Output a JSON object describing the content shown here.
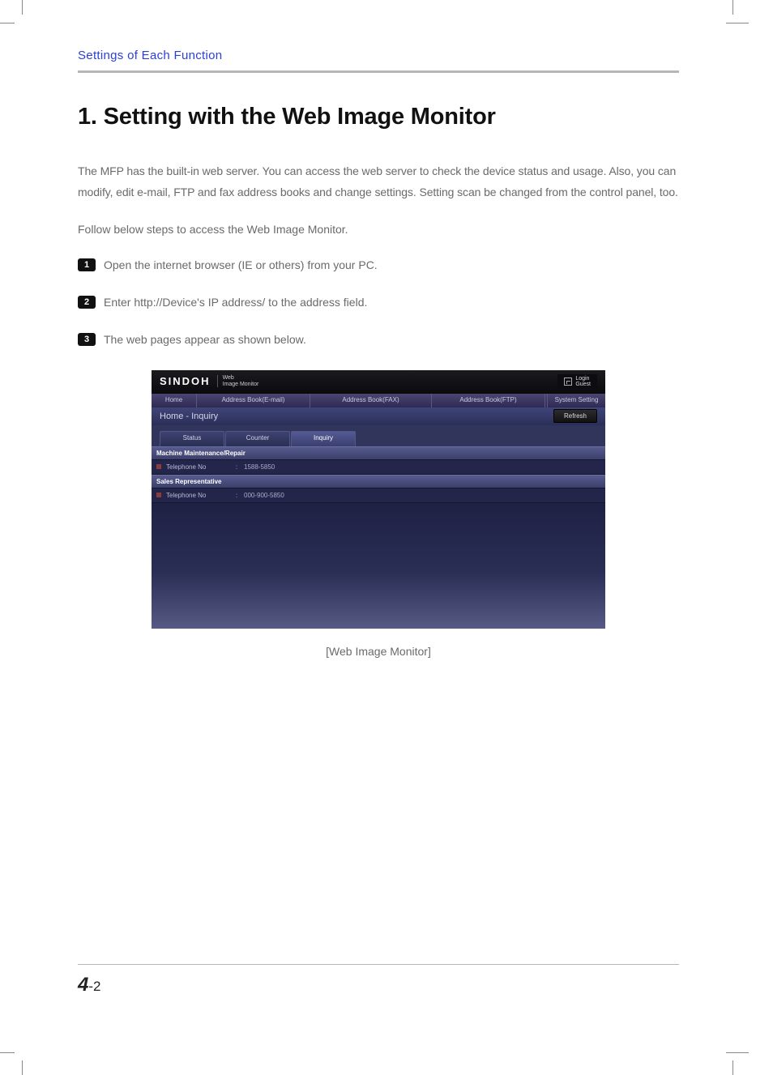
{
  "section_title": "Settings of Each Function",
  "heading": "1. Setting with the Web Image Monitor",
  "para1": "The MFP has the built-in web server. You can access the web server to check the device status and usage. Also, you can modify, edit e-mail, FTP and fax address books and change settings. Setting scan be changed from the control panel, too.",
  "para2": "Follow below steps to access the Web Image Monitor.",
  "steps": {
    "s1": "Open the internet browser (IE or others) from your PC.",
    "s2": "Enter http://Device's IP address/ to the address field.",
    "s3": "The web pages appear as shown below."
  },
  "figure": {
    "logo": "SINDOH",
    "sub1": "Web",
    "sub2": "Image Monitor",
    "login_line1": "Login",
    "login_line2": "Guest",
    "nav": {
      "home": "Home",
      "email": "Address Book(E-mail)",
      "fax": "Address Book(FAX)",
      "ftp": "Address Book(FTP)",
      "sys": "System Setting"
    },
    "breadcrumb": "Home - Inquiry",
    "refresh": "Refresh",
    "tabs": {
      "status": "Status",
      "counter": "Counter",
      "inquiry": "Inquiry"
    },
    "sections": {
      "maint_hdr": "Machine Maintenance/Repair",
      "maint_tel_label": "Telephone No",
      "maint_tel_value": "1588-5850",
      "sales_hdr": "Sales Representative",
      "sales_tel_label": "Telephone No",
      "sales_tel_value": "000-900-5850"
    }
  },
  "caption": "[Web Image Monitor]",
  "page_chapter": "4",
  "page_num": "-2"
}
